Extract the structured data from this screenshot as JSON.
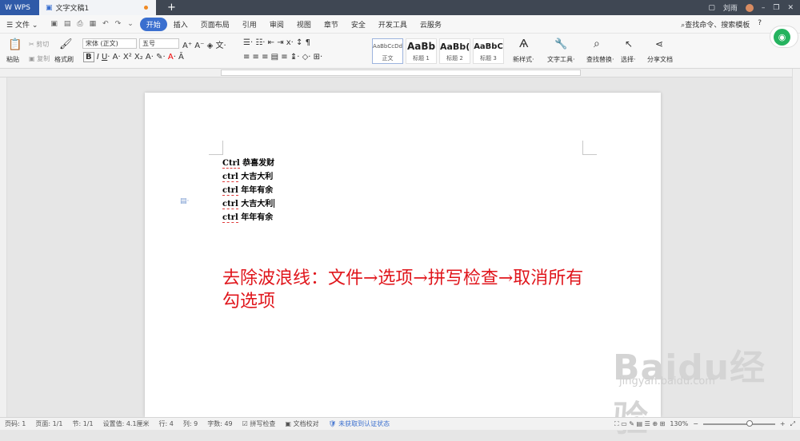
{
  "titlebar": {
    "app": "WPS",
    "doc_tab": "文字文稿1",
    "user": "刘雨"
  },
  "menubar": {
    "file": "文件",
    "start": "开始",
    "insert": "插入",
    "layout": "页面布局",
    "ref": "引用",
    "review": "审阅",
    "view": "视图",
    "chapter": "章节",
    "security": "安全",
    "devtools": "开发工具",
    "cloud": "云服务",
    "search_cmd": "查找命令、搜索模板",
    "help": "?"
  },
  "ribbon": {
    "paste": "粘贴",
    "cut": "剪切",
    "copy": "复制",
    "format_painter": "格式刷",
    "font": "宋体 (正文)",
    "size": "五号",
    "styles": [
      {
        "preview": "AaBbCcDd",
        "name": "正文"
      },
      {
        "preview": "AaBb",
        "name": "标题 1"
      },
      {
        "preview": "AaBb(",
        "name": "标题 2"
      },
      {
        "preview": "AaBbC",
        "name": "标题 3"
      }
    ],
    "new_style": "新样式",
    "text_tool": "文字工具",
    "find_replace": "查找替换",
    "select": "选择",
    "share": "分享文档"
  },
  "doc": {
    "lines": [
      {
        "ctrl": "Ctrl",
        "text": " 恭喜发财"
      },
      {
        "ctrl": "ctrl",
        "text": " 大吉大利"
      },
      {
        "ctrl": "ctrl",
        "text": " 年年有余"
      },
      {
        "ctrl": "ctrl",
        "text": " 大吉大利"
      },
      {
        "ctrl": "ctrl",
        "text": " 年年有余"
      }
    ],
    "note": "去除波浪线：文件→选项→拼写检查→取消所有勾选项"
  },
  "status": {
    "page": "页码: 1",
    "pages": "页面: 1/1",
    "section": "节: 1/1",
    "setvalue": "设置值: 4.1厘米",
    "row": "行: 4",
    "col": "列: 9",
    "words": "字数: 49",
    "spell": "拼写检查",
    "proof": "文档校对",
    "cert": "未获取到认证状态",
    "zoom": "130%"
  },
  "watermark": {
    "main": "Baidu经验",
    "sub": "jingyan.baidu.com"
  }
}
